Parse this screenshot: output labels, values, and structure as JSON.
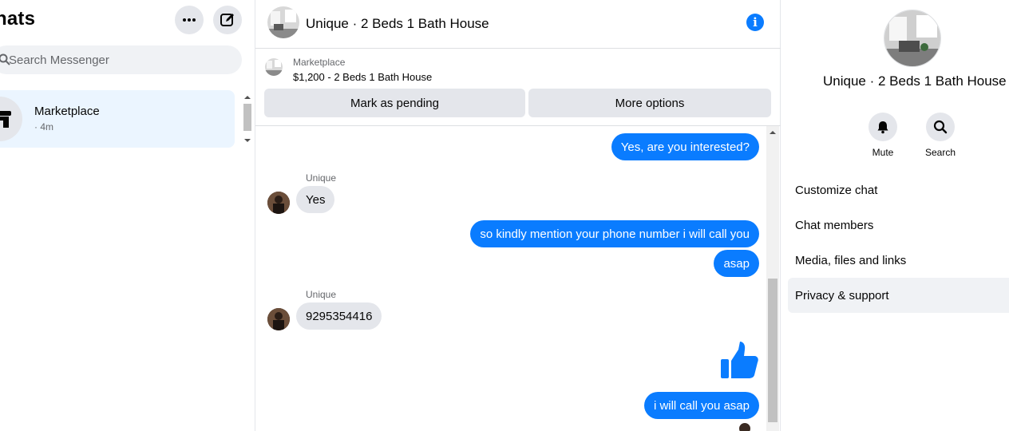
{
  "left": {
    "title": "hats",
    "search_placeholder": "Search Messenger",
    "conversations": [
      {
        "name": "Marketplace",
        "time": "· 4m"
      }
    ]
  },
  "header": {
    "title": "Unique · 2 Beds 1 Bath House"
  },
  "marketplace_bar": {
    "label": "Marketplace",
    "listing": "$1,200 - 2 Beds 1 Bath House",
    "buttons": {
      "pending": "Mark as pending",
      "more": "More options"
    }
  },
  "messages": [
    {
      "dir": "out",
      "text": "Yes, are you interested?"
    },
    {
      "dir": "in",
      "sender": "Unique",
      "text": "Yes"
    },
    {
      "dir": "out",
      "text": "so kindly mention your phone number i will call you"
    },
    {
      "dir": "out",
      "text": "asap"
    },
    {
      "dir": "in",
      "sender": "Unique",
      "text": "9295354416"
    },
    {
      "dir": "out",
      "text": "[thumbs-up]"
    },
    {
      "dir": "out",
      "text": "i will call you asap"
    }
  ],
  "right_panel": {
    "title": "Unique · 2 Beds 1 Bath House",
    "actions": [
      {
        "label": "Mute",
        "icon": "bell-icon"
      },
      {
        "label": "Search",
        "icon": "search-icon"
      }
    ],
    "menu": [
      {
        "label": "Customize chat"
      },
      {
        "label": "Chat members"
      },
      {
        "label": "Media, files and links"
      },
      {
        "label": "Privacy & support",
        "active": true
      }
    ]
  },
  "colors": {
    "accent": "#0a7cff",
    "bubble_in": "#e4e6eb",
    "selected_row": "#ebf5ff"
  }
}
